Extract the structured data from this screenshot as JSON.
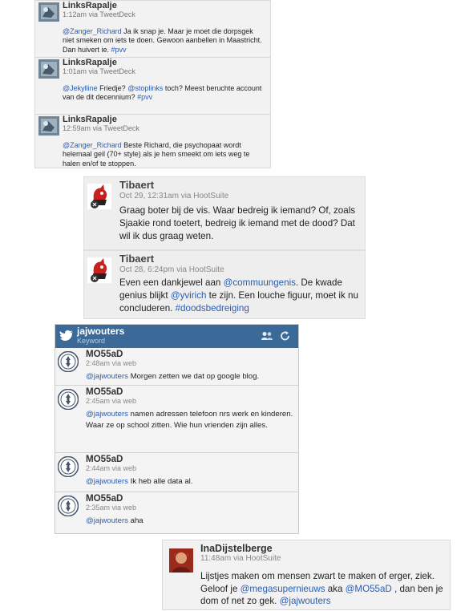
{
  "group1": {
    "tweets": [
      {
        "user": "LinksRapalje",
        "meta": "1:12am via TweetDeck",
        "parts": [
          {
            "t": "mention",
            "v": "@Zanger_Richard"
          },
          {
            "t": "text",
            "v": " Ja ik snap je. Maar je moet die dorpsgek niet smeken om iets te doen. Gewoon aanbellen in Maastricht. Dan huivert ie. "
          },
          {
            "t": "hashtag",
            "v": "#pvv"
          }
        ]
      },
      {
        "user": "LinksRapalje",
        "meta": "1:01am via TweetDeck",
        "parts": [
          {
            "t": "mention",
            "v": "@Jekylline"
          },
          {
            "t": "text",
            "v": " Friedje? "
          },
          {
            "t": "mention",
            "v": "@stoplinks"
          },
          {
            "t": "text",
            "v": " toch? Meest beruchte account van de dit decennium? "
          },
          {
            "t": "hashtag",
            "v": "#pvv"
          }
        ]
      },
      {
        "user": "LinksRapalje",
        "meta": "12:59am via TweetDeck",
        "parts": [
          {
            "t": "mention",
            "v": "@Zanger_Richard"
          },
          {
            "t": "text",
            "v": " Beste Richard, die psychopaat wordt helemaal geil (70+ style) als je hem smeekt om iets weg te halen en/of te stoppen."
          }
        ]
      }
    ]
  },
  "group2": {
    "tweets": [
      {
        "user": "Tibaert",
        "meta": "Oct 29, 12:31am via HootSuite",
        "parts": [
          {
            "t": "text",
            "v": "Graag boter bij de vis. Waar bedreig ik iemand? Of, zoals Sjaakie rond toetert, bedreig ik iemand met de dood? Dat wil ik dus graag weten."
          }
        ]
      },
      {
        "user": "Tibaert",
        "meta": "Oct 28, 6:24pm via HootSuite",
        "parts": [
          {
            "t": "text",
            "v": "Even een dankjewel aan "
          },
          {
            "t": "mention",
            "v": "@commuungenis"
          },
          {
            "t": "text",
            "v": ". De kwade genius blijkt "
          },
          {
            "t": "mention",
            "v": "@yvirich"
          },
          {
            "t": "text",
            "v": " te zijn. Een louche figuur, moet ik nu concluderen. "
          },
          {
            "t": "hashtag",
            "v": "#doodsbedreiging"
          }
        ]
      }
    ]
  },
  "group3": {
    "column_title": "jajwouters",
    "column_subtitle": "Keyword",
    "tweets": [
      {
        "user": "MO55aD",
        "meta": "2:48am via web",
        "parts": [
          {
            "t": "mention",
            "v": "@jajwouters"
          },
          {
            "t": "text",
            "v": " Morgen zetten we dat op google blog."
          }
        ]
      },
      {
        "user": "MO55aD",
        "meta": "2:45am via web",
        "parts": [
          {
            "t": "mention",
            "v": "@jajwouters"
          },
          {
            "t": "text",
            "v": " namen adressen telefoon nrs werk en kinderen. Waar ze op school zitten. Wie hun vrienden zijn alles."
          }
        ]
      },
      {
        "user": "MO55aD",
        "meta": "2:44am via web",
        "parts": [
          {
            "t": "mention",
            "v": "@jajwouters"
          },
          {
            "t": "text",
            "v": " Ik heb alle data al."
          }
        ]
      },
      {
        "user": "MO55aD",
        "meta": "2:35am via web",
        "parts": [
          {
            "t": "mention",
            "v": "@jajwouters"
          },
          {
            "t": "text",
            "v": " aha"
          }
        ]
      }
    ]
  },
  "group4": {
    "user": "InaDijstelberge",
    "meta": "11:48am via HootSuite",
    "parts": [
      {
        "t": "text",
        "v": "Lijstjes maken om mensen zwart te maken of erger, ziek. Geloof je "
      },
      {
        "t": "mention",
        "v": "@megasupernieuws"
      },
      {
        "t": "text",
        "v": " aka "
      },
      {
        "t": "mention",
        "v": "@MO55aD"
      },
      {
        "t": "text",
        "v": " , dan ben je dom of net zo gek. "
      },
      {
        "t": "mention",
        "v": "@jajwouters"
      }
    ]
  },
  "icons": {
    "twitter_bird": "bird-icon",
    "users": "users-icon",
    "refresh": "refresh-icon"
  },
  "colors": {
    "link": "#2a5db0",
    "column_header": "#3b6a99"
  }
}
